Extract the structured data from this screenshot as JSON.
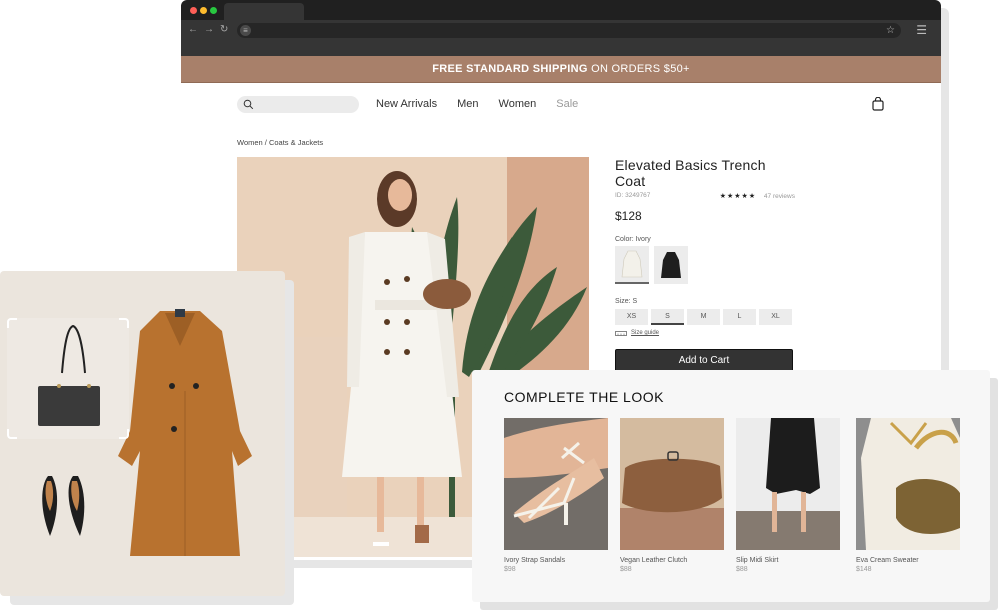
{
  "browser": {
    "traffic_lights": [
      "#ff5f57",
      "#febc2e",
      "#28c840"
    ],
    "nav": {
      "back": "←",
      "forward": "→",
      "reload": "↻"
    },
    "url_icon": "≡",
    "bookmark_icon": "☆",
    "menu_icon": "☰"
  },
  "promo": {
    "bold": "FREE STANDARD SHIPPING",
    "rest": " ON ORDERS $50+"
  },
  "sitenav": {
    "search_placeholder": "",
    "links": [
      "New Arrivals",
      "Men",
      "Women",
      "Sale"
    ]
  },
  "breadcrumb": "Women / Coats & Jackets",
  "product": {
    "title": "Elevated Basics Trench Coat",
    "id": "ID: 3249767",
    "rating": 5,
    "stars": "★★★★★",
    "reviews": "47 reviews",
    "price": "$128",
    "color_label": "Color: Ivory",
    "colors": [
      {
        "name": "Ivory",
        "selected": true,
        "hex": "#ece8de"
      },
      {
        "name": "Black",
        "selected": false,
        "hex": "#1e1e1e"
      }
    ],
    "size_label": "Size: S",
    "sizes": [
      {
        "label": "XS",
        "selected": false
      },
      {
        "label": "S",
        "selected": true
      },
      {
        "label": "M",
        "selected": false
      },
      {
        "label": "L",
        "selected": false
      },
      {
        "label": "XL",
        "selected": false
      }
    ],
    "size_guide": "Size guide",
    "add_to_cart": "Add to Cart"
  },
  "complete_the_look": {
    "title": "COMPLETE THE LOOK",
    "items": [
      {
        "name": "Ivory Strap Sandals",
        "price": "$98"
      },
      {
        "name": "Vegan Leather Clutch",
        "price": "$88"
      },
      {
        "name": "Slip Midi Skirt",
        "price": "$88"
      },
      {
        "name": "Eva Cream Sweater",
        "price": "$148"
      }
    ]
  },
  "colors": {
    "promo_bg": "#a8806a",
    "cart_button": "#333333",
    "coat_camel": "#b8722f"
  }
}
